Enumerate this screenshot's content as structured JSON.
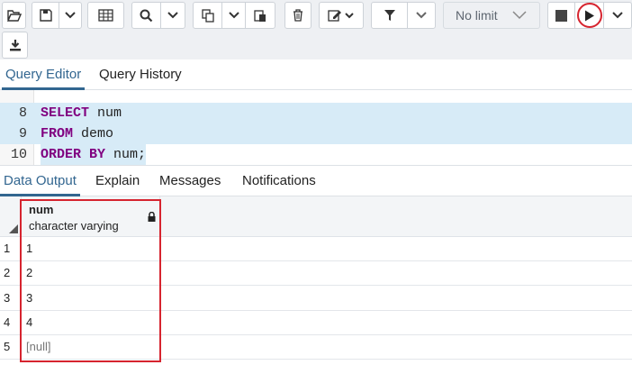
{
  "toolbar": {
    "icons": [
      "folder-open-icon",
      "save-icon",
      "chevron-down-icon",
      "grid-icon",
      "search-icon",
      "chevron-down-icon",
      "copy-icon",
      "chevron-down-icon",
      "paste-icon",
      "trash-icon",
      "edit-icon",
      "filter-icon",
      "stop-icon",
      "play-icon",
      "download-icon"
    ],
    "limit_label": "No limit"
  },
  "editor_tabs": [
    {
      "label": "Query Editor",
      "active": true
    },
    {
      "label": "Query History",
      "active": false
    }
  ],
  "editor": {
    "lines": [
      {
        "number": "8",
        "keyword": "SELECT",
        "rest": " num"
      },
      {
        "number": "9",
        "keyword": "FROM",
        "rest": " demo"
      },
      {
        "number": "10",
        "keyword": "ORDER BY",
        "rest": " num;"
      }
    ]
  },
  "output_tabs": [
    {
      "label": "Data Output",
      "active": true
    },
    {
      "label": "Explain",
      "active": false
    },
    {
      "label": "Messages",
      "active": false
    },
    {
      "label": "Notifications",
      "active": false
    }
  ],
  "grid": {
    "column": {
      "name": "num",
      "type": "character varying"
    },
    "rows": [
      {
        "n": "1",
        "value": "1"
      },
      {
        "n": "2",
        "value": "2"
      },
      {
        "n": "3",
        "value": "3"
      },
      {
        "n": "4",
        "value": "4"
      },
      {
        "n": "5",
        "value": "[null]"
      }
    ]
  },
  "colors": {
    "accent": "#326690",
    "highlight": "#d7ebf7",
    "keyword": "#800080",
    "annotation": "#d6242f"
  }
}
